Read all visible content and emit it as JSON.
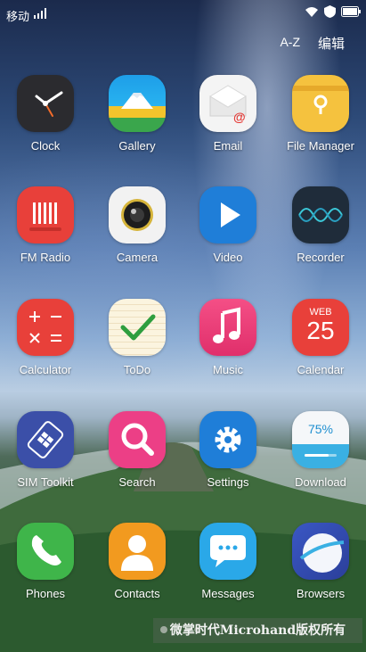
{
  "status_bar": {
    "carrier": "移动",
    "battery_icon": "battery-icon",
    "wifi_icon": "wifi-icon"
  },
  "top_bar": {
    "sort": "A-Z",
    "edit": "编辑"
  },
  "apps": [
    {
      "label": "Clock"
    },
    {
      "label": "Gallery"
    },
    {
      "label": "Email"
    },
    {
      "label": "File Manager"
    },
    {
      "label": "FM Radio"
    },
    {
      "label": "Camera"
    },
    {
      "label": "Video"
    },
    {
      "label": "Recorder"
    },
    {
      "label": "Calculator"
    },
    {
      "label": "ToDo"
    },
    {
      "label": "Music"
    },
    {
      "label": "Calendar"
    },
    {
      "label": "SIM Toolkit"
    },
    {
      "label": "Search"
    },
    {
      "label": "Settings"
    },
    {
      "label": "Download"
    },
    {
      "label": "Phones"
    },
    {
      "label": "Contacts"
    },
    {
      "label": "Messages"
    },
    {
      "label": "Browsers"
    }
  ],
  "calendar": {
    "month": "WEB",
    "day": "25"
  },
  "download": {
    "progress_text": "75%",
    "progress": 0.75
  },
  "email_at": "@",
  "watermark": "微掌时代Microhand版权所有"
}
